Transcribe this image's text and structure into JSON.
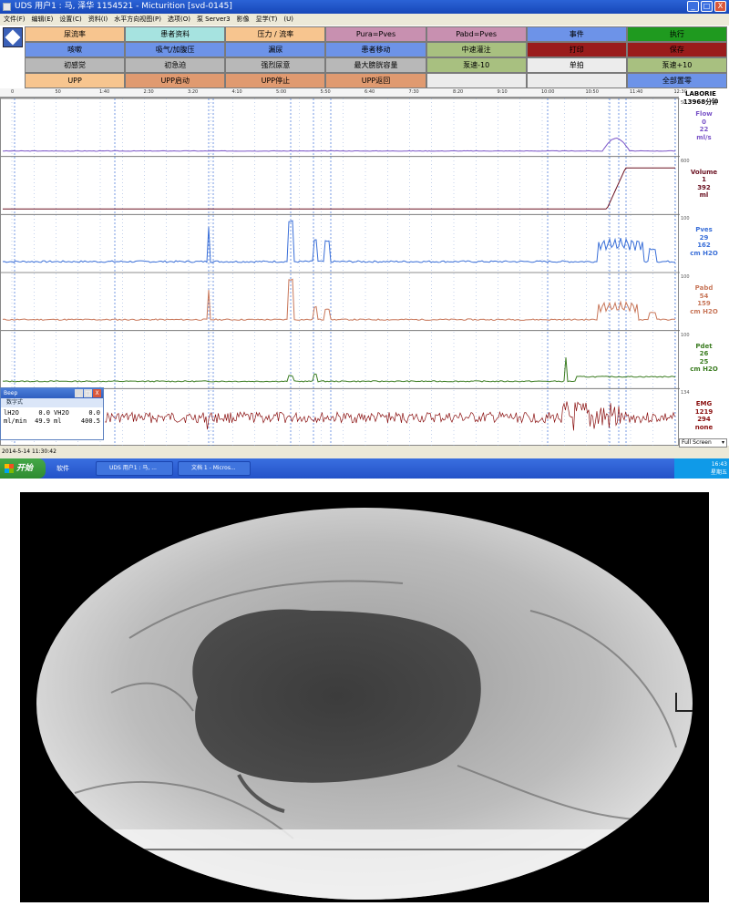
{
  "window": {
    "title": "UDS 用户1 : 马, 泽华   1154521 - Micturition [svd-0145]",
    "min": "_",
    "max": "□",
    "close": "X"
  },
  "menu": [
    "文件(F)",
    "编辑(E)",
    "设置(C)",
    "资料(I)",
    "水平方向视图(P)",
    "选项(O)",
    "泵 Server3",
    "影像",
    "显学(T)",
    "(U)"
  ],
  "buttons": [
    {
      "label": "尿流率",
      "color": "#f7c58f"
    },
    {
      "label": "患者资料",
      "color": "#a6e3e0"
    },
    {
      "label": "压力 / 流率",
      "color": "#f7c58f"
    },
    {
      "label": "Pura=Pves",
      "color": "#c890b0"
    },
    {
      "label": "Pabd=Pves",
      "color": "#c890b0"
    },
    {
      "label": "事件",
      "color": "#6d93e8"
    },
    {
      "label": "执行",
      "color": "#1f9a1f"
    },
    {
      "label": "咳嗽",
      "color": "#6d93e8"
    },
    {
      "label": "吸气/加腹压",
      "color": "#6d93e8"
    },
    {
      "label": "漏尿",
      "color": "#6d93e8"
    },
    {
      "label": "患者移动",
      "color": "#6d93e8"
    },
    {
      "label": "中速灌注",
      "color": "#a8c080"
    },
    {
      "label": "打印",
      "color": "#9a1c1c"
    },
    {
      "label": "保存",
      "color": "#9a1c1c"
    },
    {
      "label": "初感觉",
      "color": "#b8b8b8"
    },
    {
      "label": "初急迫",
      "color": "#b8b8b8"
    },
    {
      "label": "强烈尿意",
      "color": "#b8b8b8"
    },
    {
      "label": "最大膀胱容量",
      "color": "#b8b8b8"
    },
    {
      "label": "泵速-10",
      "color": "#a8c080"
    },
    {
      "label": "单拍",
      "color": "#ececec"
    },
    {
      "label": "泵速+10",
      "color": "#a8c080"
    },
    {
      "label": "UPP",
      "color": "#f7c58f"
    },
    {
      "label": "UPP启动",
      "color": "#e09a70"
    },
    {
      "label": "UPP停止",
      "color": "#e09a70"
    },
    {
      "label": "UPP返回",
      "color": "#e09a70"
    },
    {
      "label": "",
      "color": "#ececec"
    },
    {
      "label": "",
      "color": "#ececec"
    },
    {
      "label": "全部置零",
      "color": "#6d93e8"
    }
  ],
  "ruler": {
    "ticks": [
      {
        "label": "0"
      },
      {
        "label": "50"
      },
      {
        "label": "1:40"
      },
      {
        "label": "2:30"
      },
      {
        "label": "3:20"
      },
      {
        "label": "4:10"
      },
      {
        "label": "5:00"
      },
      {
        "label": "5:50"
      },
      {
        "label": "6:40"
      },
      {
        "label": "7:30"
      },
      {
        "label": "8:20"
      },
      {
        "label": "9:10"
      },
      {
        "label": "10:00"
      },
      {
        "label": "10:50"
      },
      {
        "label": "11:40"
      },
      {
        "label": "12:30"
      }
    ],
    "laborie": "LABORIE",
    "minutes": "13968分钟"
  },
  "channels": [
    {
      "name": "Flow",
      "v1": "0",
      "v2": "22",
      "unit": "ml/s",
      "color": "#7b55c8",
      "scale_top": "50",
      "scale_bottom": "0"
    },
    {
      "name": "Volume",
      "v1": "1",
      "v2": "392",
      "unit": "ml",
      "color": "#6a1020",
      "scale_top": "600",
      "scale_bottom": "0"
    },
    {
      "name": "Pves",
      "v1": "29",
      "v2": "162",
      "unit": "cm H2O",
      "color": "#3a6fd8",
      "scale_top": "100",
      "scale_bottom": "0"
    },
    {
      "name": "Pabd",
      "v1": "54",
      "v2": "159",
      "unit": "cm H2O",
      "color": "#c8775a",
      "scale_top": "100",
      "scale_bottom": "0"
    },
    {
      "name": "Pdet",
      "v1": "26",
      "v2": "25",
      "unit": "cm H2O",
      "color": "#3c7d22",
      "scale_top": "100",
      "scale_bottom": "0"
    },
    {
      "name": "EMG",
      "v1": "1219",
      "v2": "294",
      "unit": "none",
      "color": "#8a1010",
      "scale_top": "134",
      "scale_bottom": "-134"
    }
  ],
  "popup": {
    "title": "Beep",
    "subtitle": "数字式",
    "row1_left": "lH2O",
    "row1_left_val": "0.0",
    "row1_right": "VH2O",
    "row1_right_val": "0.0",
    "row2_left": "ml/min",
    "row2_left_val": "49.9",
    "row2_right": "ml",
    "row2_right_val": "400.5"
  },
  "status": {
    "datetime": "2014-5-14 11:30:42"
  },
  "fullscreen": {
    "label": "Full Screen"
  },
  "taskbar": {
    "start": "开始",
    "soft": "软件",
    "task1": "UDS 用户1 : 马, ...",
    "task2": "文档 1 - Micros...",
    "time": "16:43",
    "day": "星期五"
  },
  "colors": {
    "accent": "#2352c8",
    "grid_dot": "#6a8fd0"
  }
}
